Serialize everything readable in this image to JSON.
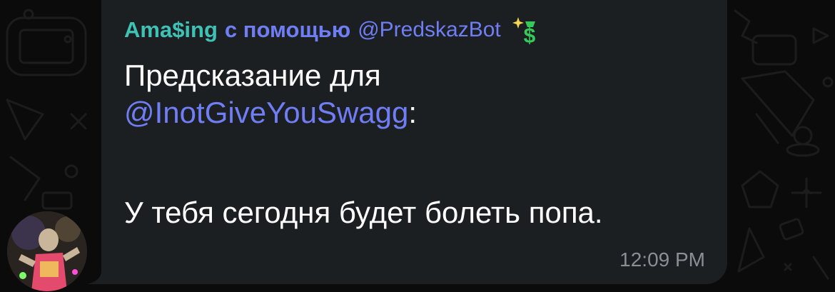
{
  "message": {
    "sender_name": "Ama$ing",
    "via_text": "с помощью",
    "bot_username": "@PredskazBot",
    "text_line_1": "Предсказание для",
    "mention": "@InotGiveYouSwagg",
    "mention_suffix": ":",
    "prediction": "У тебя сегодня будет болеть попа.",
    "time": "12:09 PM"
  },
  "colors": {
    "sender": "#3fc2b6",
    "link": "#6f7ef4",
    "bubble": "#1c1f22",
    "background": "#0b0b0b",
    "time": "#8a8f95"
  },
  "icons": {
    "badge": "money-dollar-sparkle-icon",
    "avatar": "user-avatar-photo"
  }
}
